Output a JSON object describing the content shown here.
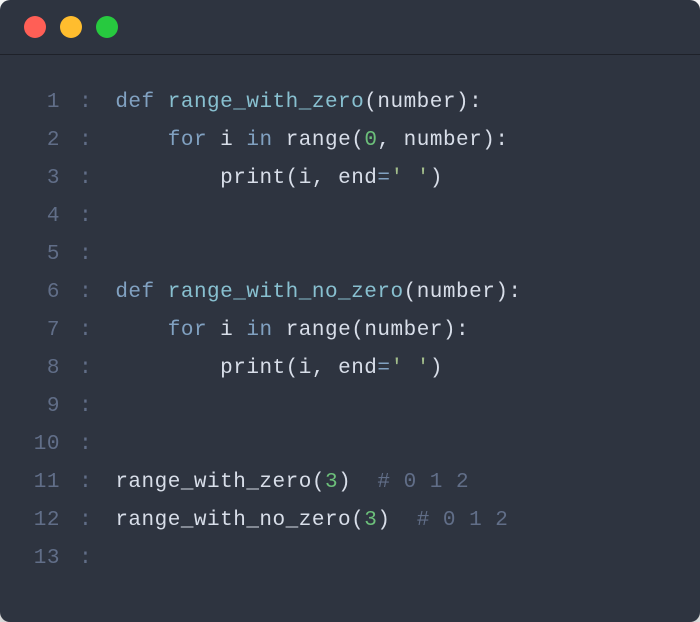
{
  "titlebar": {
    "close": "close",
    "minimize": "minimize",
    "zoom": "zoom"
  },
  "code": {
    "lines": [
      {
        "n": "1",
        "tokens": [
          {
            "c": "kw",
            "t": "def "
          },
          {
            "c": "fn",
            "t": "range_with_zero"
          },
          {
            "c": "pun",
            "t": "("
          },
          {
            "c": "id",
            "t": "number"
          },
          {
            "c": "pun",
            "t": "):"
          }
        ]
      },
      {
        "n": "2",
        "tokens": [
          {
            "c": "",
            "t": "    "
          },
          {
            "c": "kw",
            "t": "for "
          },
          {
            "c": "id",
            "t": "i"
          },
          {
            "c": "kw",
            "t": " in "
          },
          {
            "c": "bi",
            "t": "range"
          },
          {
            "c": "pun",
            "t": "("
          },
          {
            "c": "num",
            "t": "0"
          },
          {
            "c": "pun",
            "t": ", "
          },
          {
            "c": "id",
            "t": "number"
          },
          {
            "c": "pun",
            "t": "):"
          }
        ]
      },
      {
        "n": "3",
        "tokens": [
          {
            "c": "",
            "t": "        "
          },
          {
            "c": "bi",
            "t": "print"
          },
          {
            "c": "pun",
            "t": "("
          },
          {
            "c": "id",
            "t": "i"
          },
          {
            "c": "pun",
            "t": ", "
          },
          {
            "c": "id",
            "t": "end"
          },
          {
            "c": "op",
            "t": "="
          },
          {
            "c": "str",
            "t": "' '"
          },
          {
            "c": "pun",
            "t": ")"
          }
        ]
      },
      {
        "n": "4",
        "tokens": []
      },
      {
        "n": "5",
        "tokens": []
      },
      {
        "n": "6",
        "tokens": [
          {
            "c": "kw",
            "t": "def "
          },
          {
            "c": "fn",
            "t": "range_with_no_zero"
          },
          {
            "c": "pun",
            "t": "("
          },
          {
            "c": "id",
            "t": "number"
          },
          {
            "c": "pun",
            "t": "):"
          }
        ]
      },
      {
        "n": "7",
        "tokens": [
          {
            "c": "",
            "t": "    "
          },
          {
            "c": "kw",
            "t": "for "
          },
          {
            "c": "id",
            "t": "i"
          },
          {
            "c": "kw",
            "t": " in "
          },
          {
            "c": "bi",
            "t": "range"
          },
          {
            "c": "pun",
            "t": "("
          },
          {
            "c": "id",
            "t": "number"
          },
          {
            "c": "pun",
            "t": "):"
          }
        ]
      },
      {
        "n": "8",
        "tokens": [
          {
            "c": "",
            "t": "        "
          },
          {
            "c": "bi",
            "t": "print"
          },
          {
            "c": "pun",
            "t": "("
          },
          {
            "c": "id",
            "t": "i"
          },
          {
            "c": "pun",
            "t": ", "
          },
          {
            "c": "id",
            "t": "end"
          },
          {
            "c": "op",
            "t": "="
          },
          {
            "c": "str",
            "t": "' '"
          },
          {
            "c": "pun",
            "t": ")"
          }
        ]
      },
      {
        "n": "9",
        "tokens": []
      },
      {
        "n": "10",
        "tokens": []
      },
      {
        "n": "11",
        "tokens": [
          {
            "c": "id",
            "t": "range_with_zero"
          },
          {
            "c": "pun",
            "t": "("
          },
          {
            "c": "num",
            "t": "3"
          },
          {
            "c": "pun",
            "t": ")  "
          },
          {
            "c": "cmt",
            "t": "# 0 1 2"
          }
        ]
      },
      {
        "n": "12",
        "tokens": [
          {
            "c": "id",
            "t": "range_with_no_zero"
          },
          {
            "c": "pun",
            "t": "("
          },
          {
            "c": "num",
            "t": "3"
          },
          {
            "c": "pun",
            "t": ")  "
          },
          {
            "c": "cmt",
            "t": "# 0 1 2"
          }
        ]
      },
      {
        "n": "13",
        "tokens": []
      }
    ],
    "separator": ":"
  }
}
